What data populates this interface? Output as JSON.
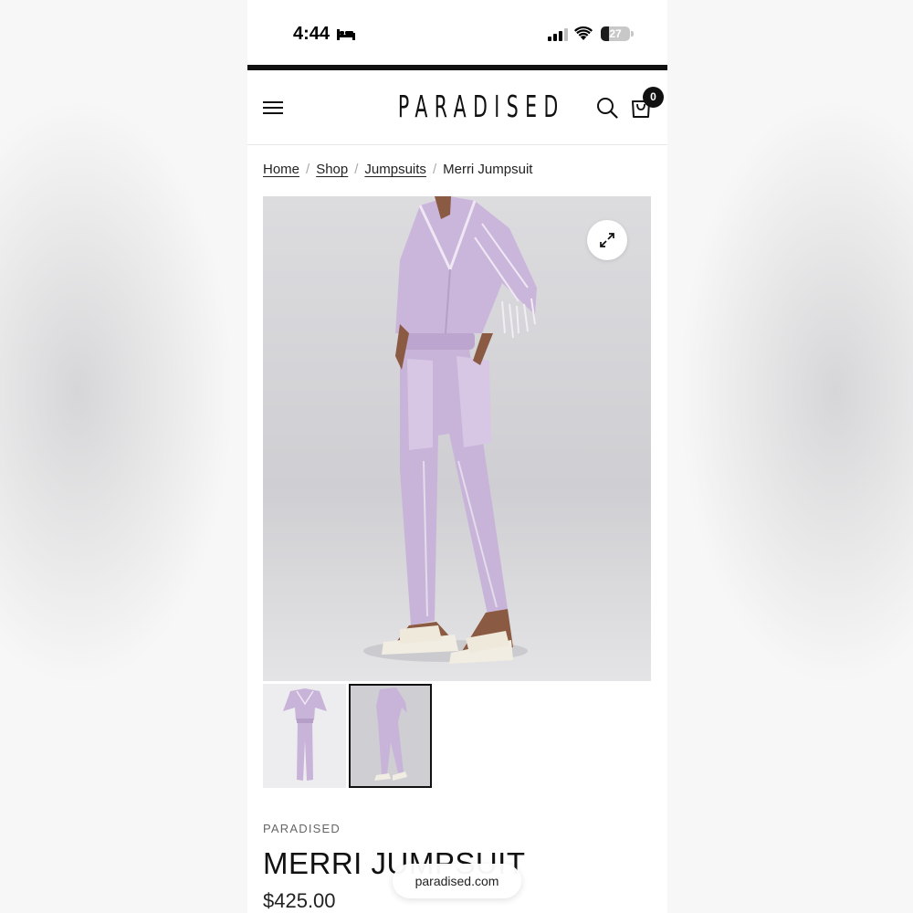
{
  "status_bar": {
    "time": "4:44",
    "battery_percent": "27",
    "battery_level": 0.27,
    "icons": [
      "bed-icon",
      "signal-icon",
      "wifi-icon",
      "battery-icon"
    ]
  },
  "header": {
    "logo": "PARADISED",
    "cart_count": "0",
    "icons": [
      "menu-icon",
      "search-icon",
      "shopping-bag-icon"
    ]
  },
  "breadcrumb": {
    "items": [
      "Home",
      "Shop",
      "Jumpsuits"
    ],
    "current": "Merri Jumpsuit",
    "separator": "/"
  },
  "gallery": {
    "main_image_subject": "model wearing lavender striped wrap jumpsuit with white sandals",
    "thumbnail_count": 2,
    "selected_thumbnail": 2,
    "expand_icon": "expand-icon"
  },
  "product": {
    "brand": "PARADISED",
    "title": "MERRI JUMPSUIT",
    "price": "$425.00"
  },
  "browser": {
    "url": "paradised.com"
  },
  "colors": {
    "jumpsuit": "#c9b4d9",
    "background_photo": "#d4d4d7",
    "accent": "#111111"
  }
}
